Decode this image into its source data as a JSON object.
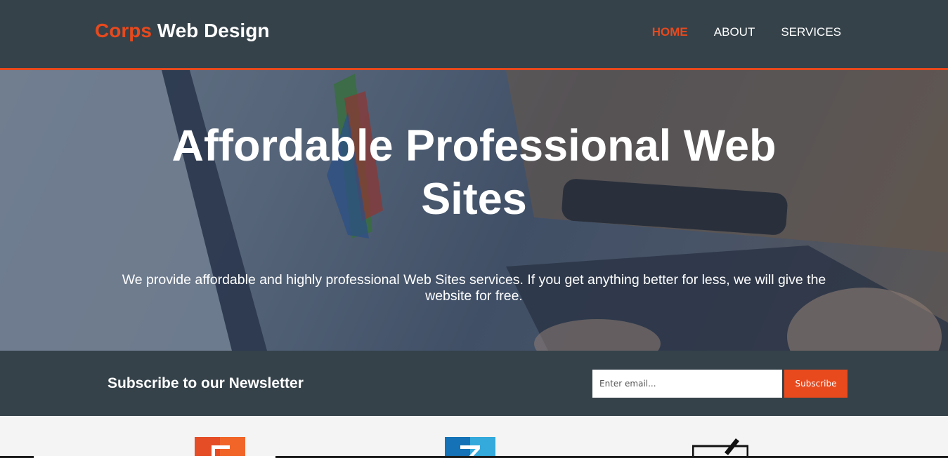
{
  "header": {
    "brand_highlight": "Corps",
    "brand_rest": "Web Design",
    "nav": [
      {
        "label": "Home",
        "active": true
      },
      {
        "label": "About",
        "active": false
      },
      {
        "label": "Services",
        "active": false
      }
    ]
  },
  "showcase": {
    "title": "Affordable Professional Web Sites",
    "text": "We provide affordable and highly professional Web Sites services. If you get anything better for less, we will give the website for free."
  },
  "newsletter": {
    "heading": "Subscribe to our Newsletter",
    "email_placeholder": "Enter email...",
    "subscribe_label": "Subscribe"
  },
  "boxes": {
    "icons": [
      "html5-icon",
      "css3-icon",
      "brush-icon"
    ]
  },
  "colors": {
    "accent": "#e8491d",
    "header_bg": "#35424a",
    "page_bg": "#f4f4f4"
  }
}
